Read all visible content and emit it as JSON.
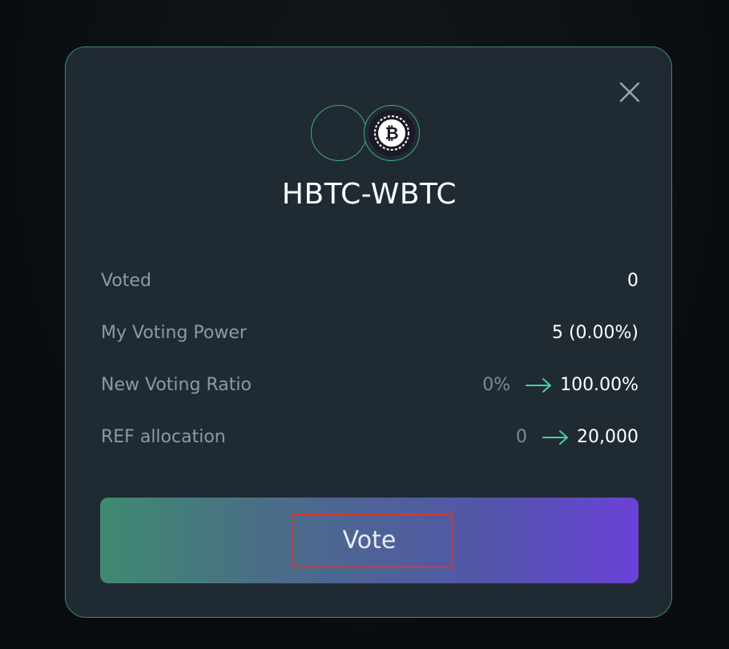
{
  "modal": {
    "pair_name": "HBTC-WBTC",
    "close_icon": "close-icon",
    "tokens": [
      {
        "icon": "token-placeholder-icon"
      },
      {
        "icon": "bitcoin-icon",
        "glyph": "₿"
      }
    ]
  },
  "stats": [
    {
      "label": "Voted",
      "value": "0"
    },
    {
      "label": "My Voting Power",
      "value": "5 (0.00%)"
    },
    {
      "label": "New Voting Ratio",
      "old_value": "0%",
      "new_value": "100.00%"
    },
    {
      "label": "REF allocation",
      "old_value": "0",
      "new_value": "20,000"
    }
  ],
  "actions": {
    "vote_label": "Vote"
  },
  "colors": {
    "accent": "#3fa889",
    "arrow": "#3fd2a6",
    "highlight": "#d23a2e",
    "gradient_start": "#3f8a70",
    "gradient_end": "#6a42d8"
  }
}
